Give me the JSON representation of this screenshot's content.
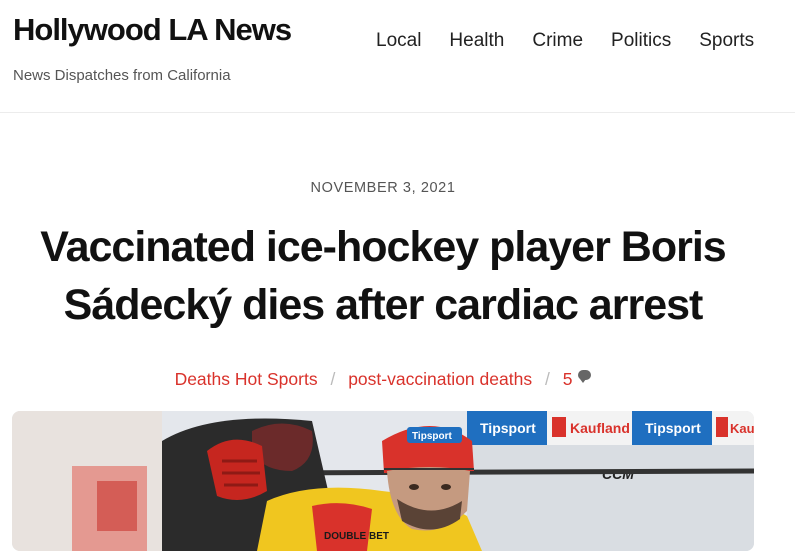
{
  "site": {
    "title": "Hollywood LA News",
    "tagline": "News Dispatches from California"
  },
  "nav": {
    "items": [
      "Local",
      "Health",
      "Crime",
      "Politics",
      "Sports"
    ]
  },
  "post": {
    "date": "NOVEMBER 3, 2021",
    "title": "Vaccinated ice-hockey player Boris Sádecký dies after cardiac arrest",
    "categories": [
      "Deaths",
      "Hot",
      "Sports"
    ],
    "tag": "post-vaccination deaths",
    "comment_count": "5"
  },
  "image_text": {
    "sponsor_1": "Tipsport",
    "sponsor_2": "Kaufland",
    "sponsor_3": "Tipsport",
    "sponsor_4": "Kauf",
    "brand": "CCM",
    "jersey_brand": "DOUBLE BET"
  },
  "colors": {
    "accent": "#d9322b",
    "text": "#111111"
  }
}
